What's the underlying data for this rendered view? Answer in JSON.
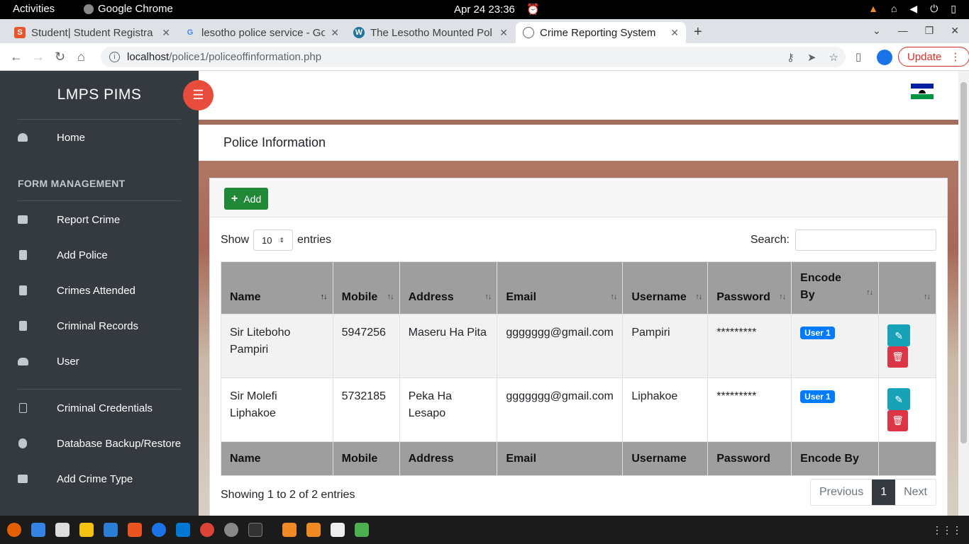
{
  "system": {
    "activities": "Activities",
    "app_name": "Google Chrome",
    "clock": "Apr 24  23:36"
  },
  "tabs": [
    {
      "title": "Student| Student Registra",
      "icon": "s-favicon",
      "color": "#e8552d"
    },
    {
      "title": "lesotho police service - Go",
      "icon": "google-favicon",
      "color": "#4285f4"
    },
    {
      "title": "The Lesotho Mounted Pol",
      "icon": "wordpress-favicon",
      "color": "#21759b"
    },
    {
      "title": "Crime Reporting System",
      "icon": "globe-favicon",
      "color": "#5f6368"
    }
  ],
  "browser": {
    "url_host": "localhost",
    "url_path": "/police1/policeoffinformation.php",
    "update_label": "Update"
  },
  "sidebar": {
    "brand": "LMPS PIMS",
    "home": "Home",
    "section": "FORM MANAGEMENT",
    "items": [
      {
        "label": "Report Crime",
        "icon": "folder-icon"
      },
      {
        "label": "Add Police",
        "icon": "file-icon"
      },
      {
        "label": "Crimes Attended",
        "icon": "file-icon"
      },
      {
        "label": "Criminal Records",
        "icon": "file-icon"
      },
      {
        "label": "User",
        "icon": "users-icon"
      },
      {
        "label": "Criminal Credentials",
        "icon": "file-outline-icon"
      },
      {
        "label": "Database Backup/Restore",
        "icon": "database-icon"
      },
      {
        "label": "Add Crime Type",
        "icon": "folder-icon"
      }
    ]
  },
  "page": {
    "title": "Police Information",
    "add_label": "Add",
    "show_label": "Show",
    "entries_value": "10",
    "entries_label": "entries",
    "search_label": "Search:",
    "search_value": ""
  },
  "table": {
    "headers": [
      "Name",
      "Mobile",
      "Address",
      "Email",
      "Username",
      "Password",
      "Encode By",
      ""
    ],
    "footers": [
      "Name",
      "Mobile",
      "Address",
      "Email",
      "Username",
      "Password",
      "Encode By",
      ""
    ],
    "rows": [
      {
        "name": "Sir Liteboho Pampiri",
        "mobile": "5947256",
        "address": "Maseru Ha Pita",
        "email": "ggggggg@gmail.com",
        "username": "Pampiri",
        "password": "*********",
        "encode_by": "User 1"
      },
      {
        "name": "Sir Molefi Liphakoe",
        "mobile": "5732185",
        "address": "Peka Ha Lesapo",
        "email": "ggggggg@gmail.com",
        "username": "Liphakoe",
        "password": "*********",
        "encode_by": "User 1"
      }
    ]
  },
  "pagination": {
    "info": "Showing 1 to 2 of 2 entries",
    "previous": "Previous",
    "current": "1",
    "next": "Next"
  },
  "colors": {
    "sidebar_bg": "#343a40",
    "add_button": "#218838",
    "edit_button": "#17a2b8",
    "delete_button": "#dc3545",
    "badge": "#007bff",
    "toggle_button": "#e74c3c"
  }
}
